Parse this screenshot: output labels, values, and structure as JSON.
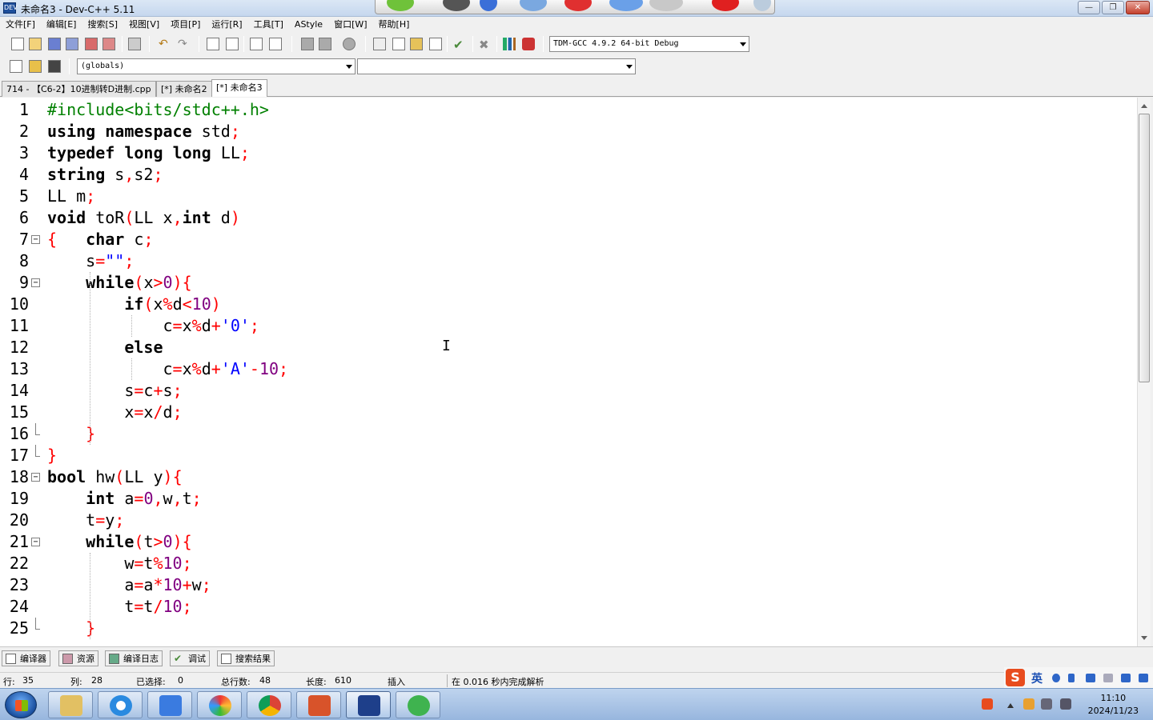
{
  "window": {
    "title": "未命名3 - Dev-C++ 5.11"
  },
  "menu": [
    "文件[F]",
    "编辑[E]",
    "搜索[S]",
    "视图[V]",
    "项目[P]",
    "运行[R]",
    "工具[T]",
    "AStyle",
    "窗口[W]",
    "帮助[H]"
  ],
  "toolbar": {
    "compiler_select": "TDM-GCC 4.9.2 64-bit Debug",
    "scope_select": "(globals)",
    "member_select": ""
  },
  "tabs": [
    {
      "label": "714 - 【C6-2】10进制转D进制.cpp",
      "active": false
    },
    {
      "label": "[*] 未命名2",
      "active": false
    },
    {
      "label": "[*] 未命名3",
      "active": true
    }
  ],
  "editor": {
    "lines": [
      {
        "n": "1"
      },
      {
        "n": "2"
      },
      {
        "n": "3"
      },
      {
        "n": "4"
      },
      {
        "n": "5"
      },
      {
        "n": "6"
      },
      {
        "n": "7"
      },
      {
        "n": "8"
      },
      {
        "n": "9"
      },
      {
        "n": "10"
      },
      {
        "n": "11"
      },
      {
        "n": "12"
      },
      {
        "n": "13"
      },
      {
        "n": "14"
      },
      {
        "n": "15"
      },
      {
        "n": "16"
      },
      {
        "n": "17"
      },
      {
        "n": "18"
      },
      {
        "n": "19"
      },
      {
        "n": "20"
      },
      {
        "n": "21"
      },
      {
        "n": "22"
      },
      {
        "n": "23"
      },
      {
        "n": "24"
      },
      {
        "n": "25"
      }
    ],
    "code_lines": [
      "#include<bits/stdc++.h>",
      "using namespace std;",
      "typedef long long LL;",
      "string s,s2;",
      "LL m;",
      "void toR(LL x,int d)",
      "{   char c;",
      "    s=\"\";",
      "    while(x>0){",
      "        if(x%d<10)",
      "            c=x%d+'0';",
      "        else",
      "            c=x%d+'A'-10;",
      "        s=c+s;",
      "        x=x/d;",
      "    }",
      "}",
      "bool hw(LL y){",
      "    int a=0,w,t;",
      "    t=y;",
      "    while(t>0){",
      "        w=t%10;",
      "        a=a*10+w;",
      "        t=t/10;",
      "    }"
    ]
  },
  "bottom_tabs": [
    "编译器",
    "资源",
    "编译日志",
    "调试",
    "搜索结果"
  ],
  "status": {
    "row_label": "行:",
    "row": "35",
    "col_label": "列:",
    "col": "28",
    "sel_label": "已选择:",
    "sel": "0",
    "total_label": "总行数:",
    "total": "48",
    "len_label": "长度:",
    "len": "610",
    "mode": "插入",
    "message": "在 0.016 秒内完成解析"
  },
  "ime": {
    "label": "英"
  },
  "taskbar": {
    "time": "11:10",
    "date": "2024/11/23"
  },
  "colors": {
    "keyword": "#000000",
    "preprocessor": "#008000",
    "symbol": "#ff0000",
    "number": "#800080",
    "string": "#0000ff"
  }
}
